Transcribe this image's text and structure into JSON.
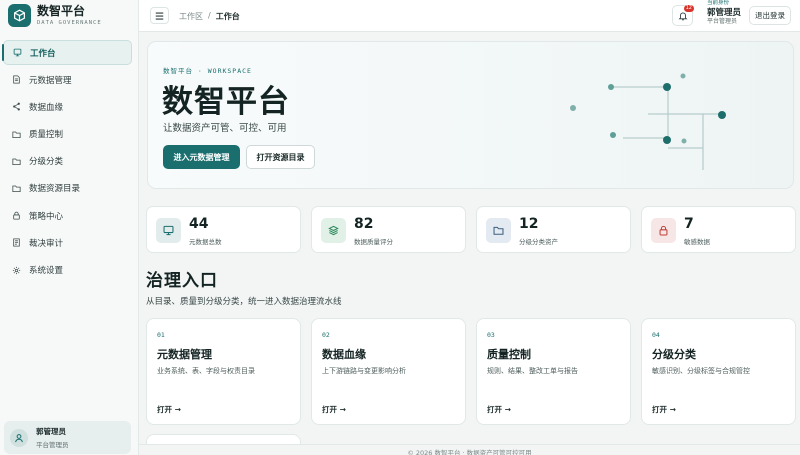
{
  "brand": {
    "title": "数智平台",
    "subtitle": "DATA GOVERNANCE"
  },
  "sidebar": {
    "items": [
      {
        "label": "工作台",
        "icon": "workbench-icon",
        "active": true
      },
      {
        "label": "元数据管理",
        "icon": "document-icon"
      },
      {
        "label": "数据血缘",
        "icon": "share-icon"
      },
      {
        "label": "质量控制",
        "icon": "folder-icon"
      },
      {
        "label": "分级分类",
        "icon": "folder-icon"
      },
      {
        "label": "数据资源目录",
        "icon": "folder-icon"
      },
      {
        "label": "策略中心",
        "icon": "lock-icon"
      },
      {
        "label": "裁决审计",
        "icon": "audit-icon"
      },
      {
        "label": "系统设置",
        "icon": "gear-icon"
      }
    ],
    "user": {
      "name": "郭管理员",
      "role": "平台管理员"
    }
  },
  "topbar": {
    "breadcrumb": [
      "工作区",
      "/",
      "工作台"
    ],
    "notifications": "12",
    "identity_label": "当前身份",
    "identity_name": "郭管理员",
    "identity_role": "平台管理员",
    "logout": "退出登录"
  },
  "hero": {
    "eyebrow": "数智平台 · WORKSPACE",
    "title": "数智平台",
    "subtitle": "让数据资产可管、可控、可用",
    "primary_btn": "进入元数据管理",
    "secondary_btn": "打开资源目录"
  },
  "stats": [
    {
      "value": "44",
      "label": "元数据总数",
      "icon": "monitor-icon",
      "color": "#e3ecec"
    },
    {
      "value": "82",
      "label": "数据质量评分",
      "icon": "layers-icon",
      "color": "#e2f1e8"
    },
    {
      "value": "12",
      "label": "分级分类资产",
      "icon": "folder-icon",
      "color": "#e3eaf1"
    },
    {
      "value": "7",
      "label": "敏感数据",
      "icon": "lock-icon",
      "color": "#f7e6e6"
    }
  ],
  "section": {
    "title": "治理入口",
    "subtitle": "从目录、质量到分级分类，统一进入数据治理流水线"
  },
  "cards": [
    {
      "num": "01",
      "title": "元数据管理",
      "desc": "业务系统、表、字段与权责目录",
      "open": "打开 →"
    },
    {
      "num": "02",
      "title": "数据血缘",
      "desc": "上下游链路与变更影响分析",
      "open": "打开 →"
    },
    {
      "num": "03",
      "title": "质量控制",
      "desc": "规则、结果、整改工单与报告",
      "open": "打开 →"
    },
    {
      "num": "04",
      "title": "分级分类",
      "desc": "敏感识别、分级标签与合规管控",
      "open": "打开 →"
    }
  ],
  "footer": "© 2026 数智平台 · 数据资产可管可控可用",
  "colors": {
    "accent": "#1a6e6e",
    "danger": "#d9342b"
  }
}
